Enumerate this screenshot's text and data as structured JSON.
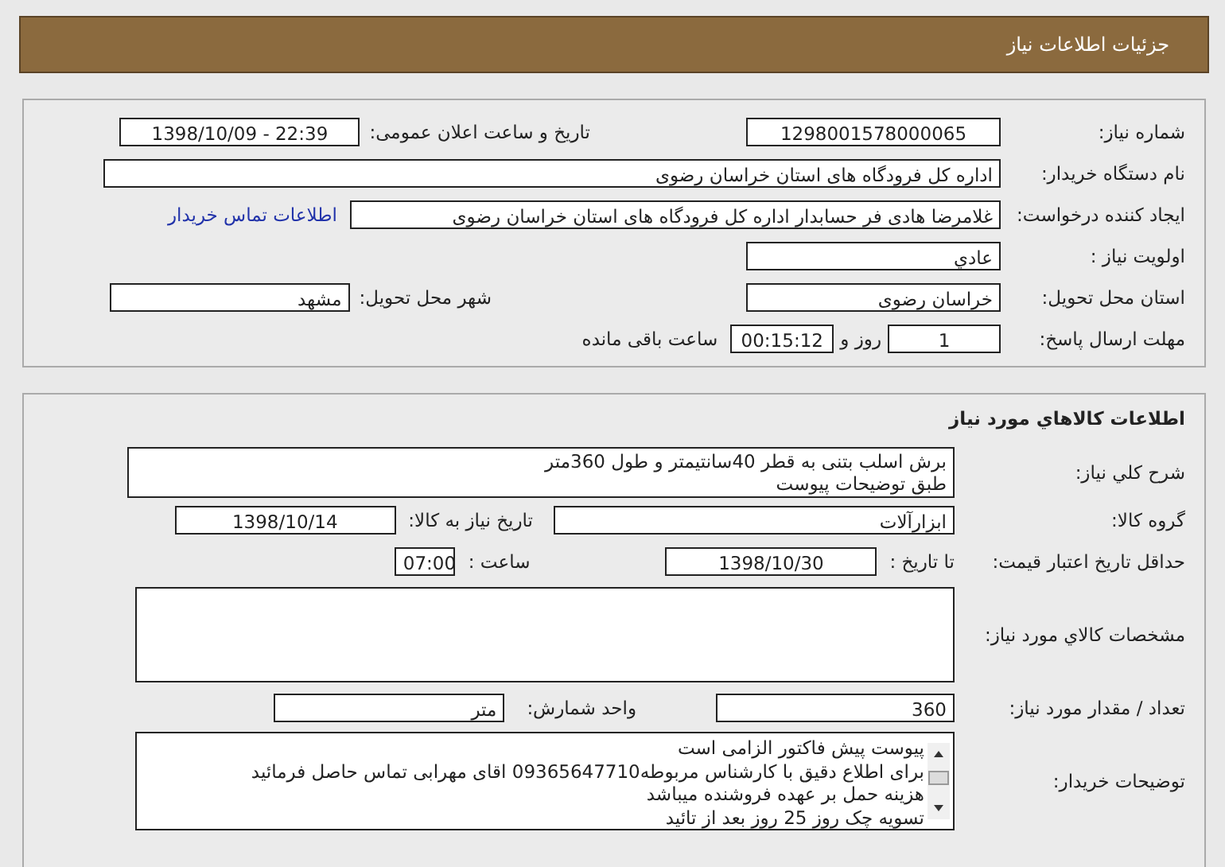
{
  "page_title": "جزئیات اطلاعات نیاز",
  "need": {
    "need_number": {
      "label": "شماره نیاز:",
      "value": "1298001578000065"
    },
    "announce": {
      "label": "تاریخ و ساعت اعلان عمومی:",
      "value": "1398/10/09 - 22:39"
    },
    "buyer": {
      "label": "نام دستگاه خریدار:",
      "value": "اداره کل فرودگاه های استان خراسان رضوی"
    },
    "creator": {
      "label": "ایجاد کننده درخواست:",
      "value": "غلامرضا هادی فر حسابدار اداره کل فرودگاه های استان خراسان رضوی",
      "link": "اطلاعات تماس خریدار"
    },
    "priority": {
      "label": "اولویت نیاز :",
      "value": "عادي"
    },
    "province": {
      "label": "استان محل تحویل:",
      "value": "خراسان رضوی"
    },
    "city": {
      "label": "شهر محل تحویل:",
      "value": "مشهد"
    },
    "deadline": {
      "label": "مهلت ارسال پاسخ:",
      "days": "1",
      "days_unit": "روز و",
      "time": "00:15:12",
      "remaining": "ساعت باقی مانده"
    }
  },
  "goods": {
    "title": "اطلاعات کالاهاي مورد نياز",
    "description": {
      "label": "شرح کلي نياز:",
      "lines": [
        "برش اسلب بتنی به قطر 40سانتیمتر و طول 360متر",
        "طبق توضیحات پیوست"
      ]
    },
    "group": {
      "label": "گروه کالا:",
      "value": "ابزارآلات"
    },
    "need_date": {
      "label": "تاریخ نیاز به کالا:",
      "value": "1398/10/14"
    },
    "price_validity": {
      "label": "حداقل تاریخ اعتبار قیمت:",
      "date_label": "تا تاریخ :",
      "date": "1398/10/30",
      "time_label": "ساعت :",
      "time": "07:00"
    },
    "specs": {
      "label": "مشخصات کالاي مورد نياز:"
    },
    "quantity": {
      "label": "تعداد / مقدار مورد نیاز:",
      "value": "360"
    },
    "unit": {
      "label": "واحد شمارش:",
      "value": "متر"
    },
    "notes": {
      "label": "توضیحات خریدار:",
      "lines": [
        "پیوست پیش فاکتور الزامی است",
        "برای اطلاع دقیق با کارشناس مربوطه09365647710 اقای مهرابی تماس حاصل فرمائید",
        "هزینه حمل بر عهده فروشنده میباشد",
        "تسویه چک روز 25 روز بعد از تائید"
      ]
    }
  }
}
